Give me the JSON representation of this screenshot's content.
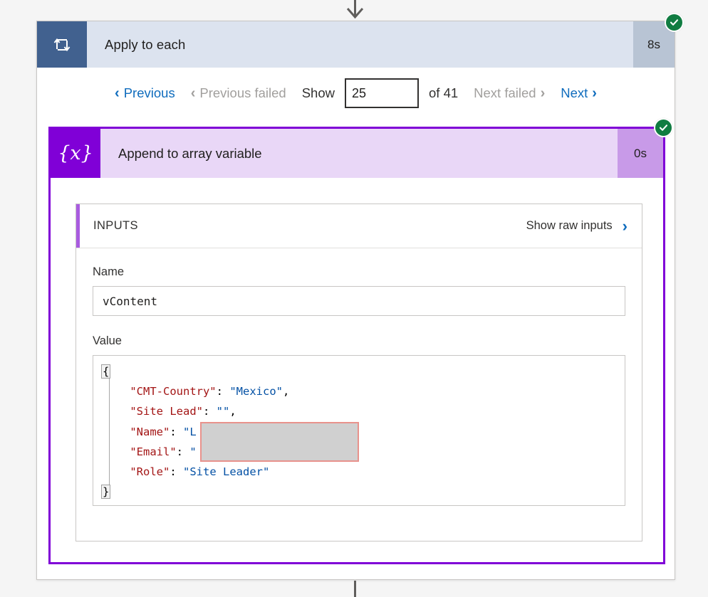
{
  "flow": {
    "scope": {
      "icon": "loop-repeat-icon",
      "title": "Apply to each",
      "duration": "8s",
      "status_icon": "success-check-icon"
    },
    "pager": {
      "previous_label": "Previous",
      "previous_failed_label": "Previous failed",
      "show_label": "Show",
      "page_value": "25",
      "page_placeholder": "",
      "of_label": "of 41",
      "next_failed_label": "Next failed",
      "next_label": "Next",
      "chevron_left": "‹",
      "chevron_right": "›"
    },
    "action": {
      "icon": "variable-braces-x-icon",
      "title": "Append to array variable",
      "duration": "0s",
      "status_icon": "success-check-icon",
      "inputs": {
        "section_title": "INPUTS",
        "raw_link_label": "Show raw inputs",
        "raw_link_icon": "chevron-right-icon",
        "name_label": "Name",
        "name_value": "vContent",
        "value_label": "Value",
        "code": {
          "open_brace": "{",
          "close_brace": "}",
          "lines": [
            {
              "key": "\"CMT-Country\"",
              "sep": ": ",
              "value": "\"Mexico\"",
              "comma": ","
            },
            {
              "key": "\"Site Lead\"",
              "sep": ": ",
              "value": "\"\"",
              "comma": ","
            },
            {
              "key": "\"Name\"",
              "sep": ": ",
              "value": "\"L",
              "comma": ""
            },
            {
              "key": "\"Email\"",
              "sep": ": ",
              "value": "\"",
              "comma": ""
            },
            {
              "key": "\"Role\"",
              "sep": ": ",
              "value": "\"Site Leader\"",
              "comma": ""
            }
          ],
          "redacted_tail_email": "\",",
          "redaction_label": "redacted-content"
        }
      }
    }
  },
  "colors": {
    "scope_header_bg": "#dce3ef",
    "scope_icon_bg": "#41618f",
    "scope_duration_bg": "#b8c4d4",
    "action_border": "#8000d7",
    "action_header_bg": "#e9d7f7",
    "action_icon_bg": "#8000d7",
    "action_duration_bg": "#c89ae8",
    "success_green": "#107c41",
    "link_blue": "#0f6cbd",
    "disabled_gray": "#a19f9d",
    "json_key": "#a31515",
    "json_string": "#0451a5",
    "redaction_fill": "#d0d0d0",
    "redaction_border": "#e8928c",
    "inputs_accent": "#a95ce0"
  }
}
